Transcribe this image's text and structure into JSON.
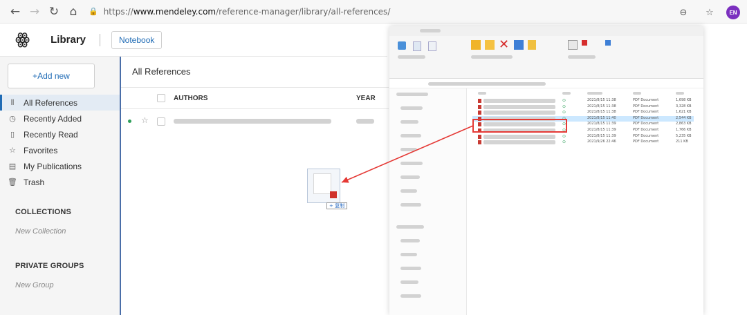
{
  "browser": {
    "url_proto": "https://",
    "url_host": "www.mendeley.com",
    "url_path": "/reference-manager/library/all-references/",
    "avatar_initials": "EN"
  },
  "app": {
    "title": "Library",
    "notebook_label": "Notebook"
  },
  "sidebar": {
    "add_new": "+Add new",
    "items": [
      {
        "label": "All References",
        "icon": "library-icon"
      },
      {
        "label": "Recently Added",
        "icon": "clock-icon"
      },
      {
        "label": "Recently Read",
        "icon": "bookmark-icon"
      },
      {
        "label": "Favorites",
        "icon": "star-icon"
      },
      {
        "label": "My Publications",
        "icon": "publication-icon"
      },
      {
        "label": "Trash",
        "icon": "trash-icon"
      }
    ],
    "collections_title": "COLLECTIONS",
    "new_collection": "New Collection",
    "private_groups_title": "PRIVATE GROUPS",
    "new_group": "New Group"
  },
  "main": {
    "title": "All References",
    "col_authors": "AUTHORS",
    "col_year": "YEAR"
  },
  "drag": {
    "copy_label": "+ 复制"
  },
  "explorer": {
    "files": [
      {
        "date": "2021/8/15 11:38",
        "type": "PDF Document",
        "size": "1,698 KB"
      },
      {
        "date": "2021/8/15 11:38",
        "type": "PDF Document",
        "size": "3,328 KB"
      },
      {
        "date": "2021/8/15 11:38",
        "type": "PDF Document",
        "size": "1,621 KB"
      },
      {
        "date": "2021/8/15 11:40",
        "type": "PDF Document",
        "size": "2,544 KB"
      },
      {
        "date": "2021/8/15 11:39",
        "type": "PDF Document",
        "size": "2,863 KB"
      },
      {
        "date": "2021/8/15 11:39",
        "type": "PDF Document",
        "size": "1,766 KB"
      },
      {
        "date": "2021/8/15 11:39",
        "type": "PDF Document",
        "size": "5,235 KB"
      },
      {
        "date": "2021/9/26 22:46",
        "type": "PDF Document",
        "size": "211 KB"
      }
    ],
    "selected_index": 3
  },
  "colors": {
    "accent": "#1f6bb5",
    "highlight": "#e53935",
    "status_green": "#2e9f5a"
  }
}
